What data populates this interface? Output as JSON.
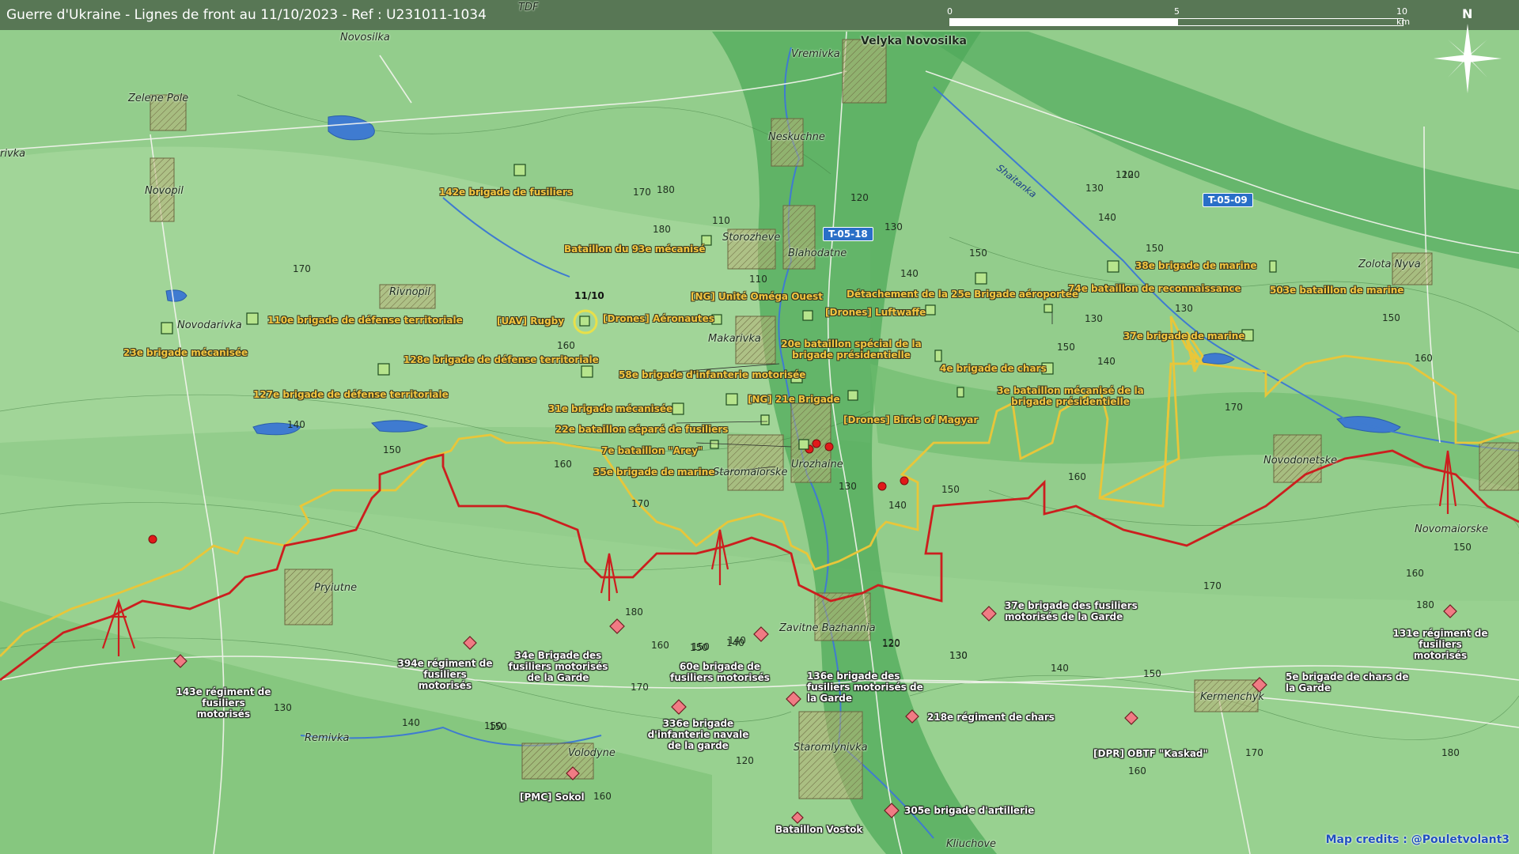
{
  "header": {
    "title": "Guerre d'Ukraine - Lignes de front au 11/10/2023 - Ref : U231011-1034"
  },
  "scale": {
    "ticks": [
      "0",
      "5",
      "10 km"
    ]
  },
  "north": {
    "label": "N"
  },
  "places": {
    "velyka": "Velyka Novosilka",
    "vremivka": "Vremivka",
    "neskuchne": "Neskuchne",
    "storozheve": "Storozheve",
    "blahodatne": "Blahodatne",
    "makarivka": "Makarivka",
    "staromaiorske": "Staromaiorske",
    "urozhaine": "Urozhaine",
    "zavitne": "Zavitne Bazhannia",
    "staromlynivka": "Staromlynivka",
    "kliuchove": "Kliuchove",
    "novosilka": "Novosilka",
    "zelene": "Zelene Pole",
    "rivka": "rivka",
    "novopil": "Novopil",
    "rivnopil": "Rivnopil",
    "novodarivka": "Novodarivka",
    "pryiutne": "Pryiutne",
    "remivka": "Remivka",
    "volodyne": "Volodyne",
    "zolota": "Zolota Nyva",
    "novodonetske": "Novodonetske",
    "novomaiorske": "Novomaiorske",
    "kermenchyk": "Kermenchyk",
    "tdf": "TDF"
  },
  "roads": {
    "r1": "T-05-18",
    "r2": "T-05-09"
  },
  "river": "Shaitanka",
  "date_label": "11/10",
  "ukr_units": {
    "u142": "142e brigade de fusiliers",
    "u93": "Bataillon du 93e mécanisé",
    "uav": "[UAV] Rugby",
    "drones_a": "[Drones] Aéronautes",
    "omega": "[NG] Unité Oméga Ouest",
    "luft": "[Drones] Luftwaffe",
    "u25": "Détachement de la 25e Brigade aéroportée",
    "u74": "74e bataillon de reconnaissance",
    "u38": "38e brigade de marine",
    "u503": "503e bataillon de marine",
    "u37": "37e brigade de marine",
    "u110": "110e brigade de défense territoriale",
    "u23": "23e brigade mécanisée",
    "u128": "128e brigade de défense territoriale",
    "u127": "127e brigade de défense territoriale",
    "u58": "58e brigade d'infanterie motorisée",
    "u20": "20e bataillon spécial de la brigade présidentielle",
    "u4": "4e brigade de chars",
    "u3": "3e bataillon mécanisé de la brigade présidentielle",
    "u31": "31e brigade mécanisée",
    "u21": "[NG] 21e Brigade",
    "birds": "[Drones] Birds of Magyar",
    "u22": "22e bataillon séparé de fusiliers",
    "arey": "7e bataillon \"Arey\"",
    "u35": "35e brigade de marine"
  },
  "rus_units": {
    "r143": "143e régiment de fusiliers motorisés",
    "r394": "394e régiment de fusiliers motorisés",
    "r34": "34e Brigade des fusiliers motorisés de la Garde",
    "r60": "60e brigade de fusiliers motorisés",
    "r336": "336e brigade d'infanterie navale de la garde",
    "r136": "136e brigade des fusiliers motorisés de la Garde",
    "r37": "37e brigade des fusiliers motorisés de la Garde",
    "r218": "218e régiment de chars",
    "dpr": "[DPR] OBTF \"Kaskad\"",
    "r5": "5e brigade de chars de la Garde",
    "r131": "131e régiment de fusiliers motorisés",
    "sokol": "[PMC] Sokol",
    "r305": "305e brigade d'artillerie",
    "vostok": "Bataillon Vostok"
  },
  "elevations": [
    "170",
    "180",
    "110",
    "120",
    "130",
    "140",
    "150",
    "160",
    "170",
    "180",
    "110",
    "130",
    "120",
    "150",
    "140",
    "130",
    "120",
    "130",
    "140",
    "150",
    "160",
    "170",
    "150",
    "140",
    "150",
    "160",
    "170",
    "140",
    "150",
    "160",
    "130",
    "140",
    "150",
    "120",
    "130",
    "140",
    "150",
    "160",
    "170",
    "180",
    "150",
    "160",
    "140",
    "150",
    "170",
    "180",
    "120",
    "130",
    "140",
    "160",
    "150",
    "170",
    "160",
    "180",
    "120",
    "130",
    "150"
  ],
  "credit": "Map credits : @Pouletvolant3",
  "colors": {
    "ukr_line": "#e8c63a",
    "rus_line": "#cc1e1e",
    "water": "#3f7bd0",
    "ukr_unit": "#f4c640",
    "rus_unit": "#f07b84"
  }
}
